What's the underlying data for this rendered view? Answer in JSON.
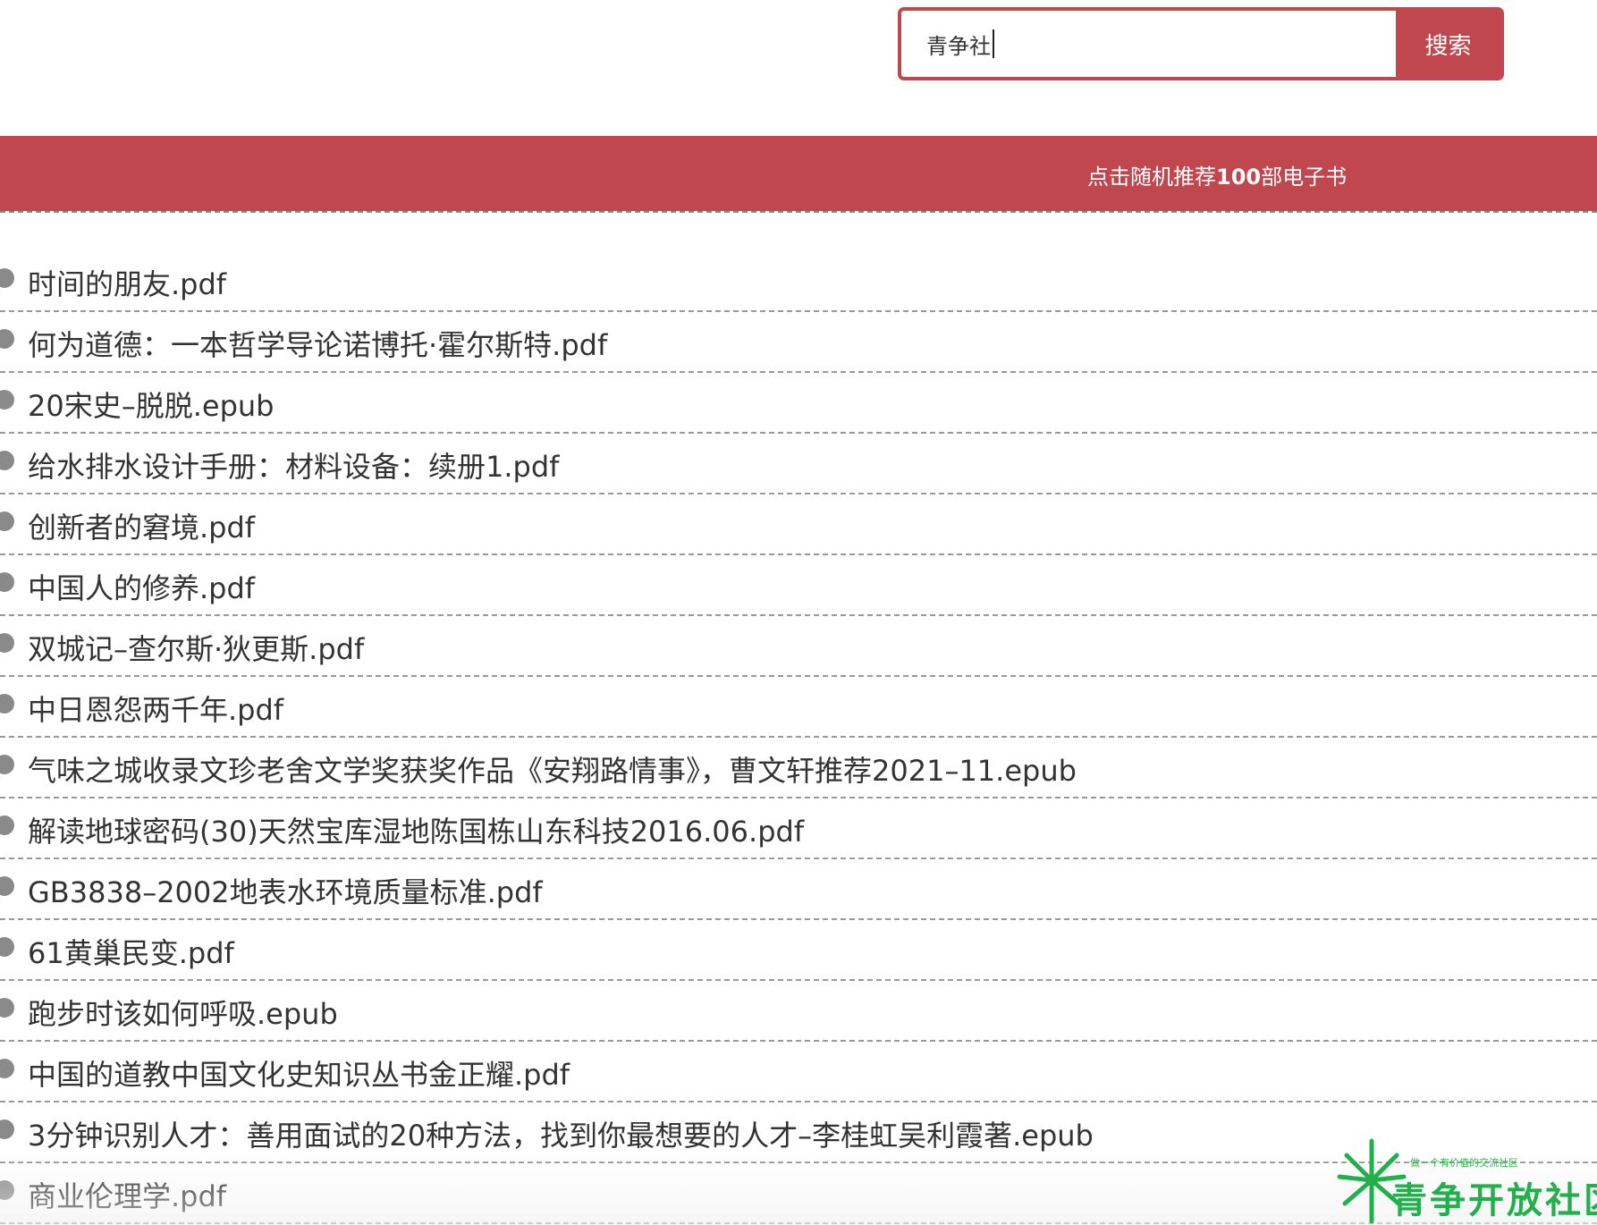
{
  "search": {
    "value": "青争社",
    "button_label": "搜索"
  },
  "banner": {
    "link_prefix": "点击随机推荐",
    "link_number": "100",
    "link_suffix": "部电子书",
    "color": "#c1474e"
  },
  "books": [
    "时间的朋友.pdf",
    "何为道德：一本哲学导论诺博托·霍尔斯特.pdf",
    "20宋史–脱脱.epub",
    "给水排水设计手册：材料设备：续册1.pdf",
    "创新者的窘境.pdf",
    "中国人的修养.pdf",
    "双城记–查尔斯·狄更斯.pdf",
    "中日恩怨两千年.pdf",
    "气味之城收录文珍老舍文学奖获奖作品《安翔路情事》，曹文轩推荐2021–11.epub",
    "解读地球密码(30)天然宝库湿地陈国栋山东科技2016.06.pdf",
    "GB3838–2002地表水环境质量标准.pdf",
    "61黄巢民变.pdf",
    "跑步时该如何呼吸.epub",
    "中国的道教中国文化史知识丛书金正耀.pdf",
    "3分钟识别人才：善用面试的20种方法，找到你最想要的人才–李桂虹吴利霞著.epub",
    "商业伦理学.pdf"
  ],
  "watermark": {
    "slogan": "做一个有价值的交流社区",
    "name": "青争开放社区",
    "icon": "sprout-logo-icon",
    "color": "#21b04b"
  }
}
